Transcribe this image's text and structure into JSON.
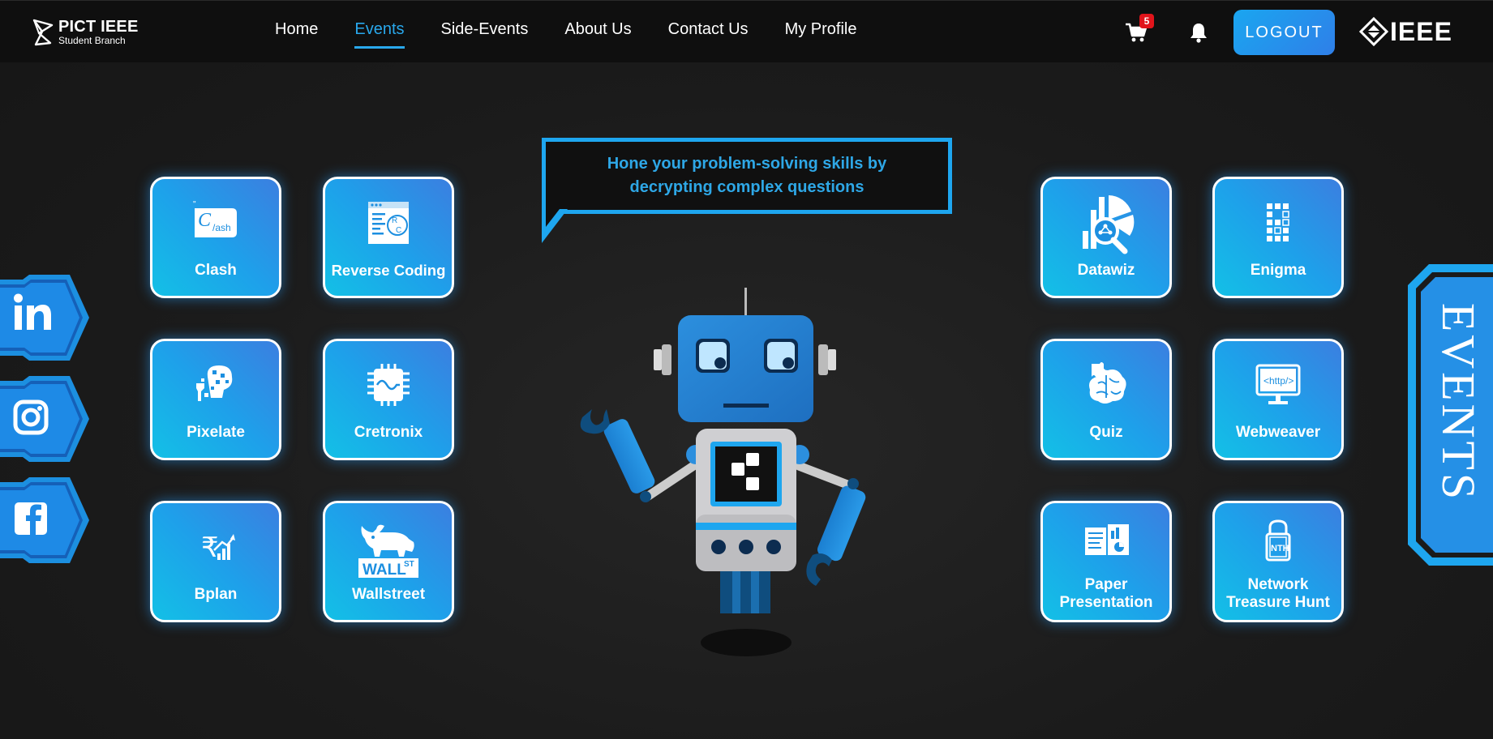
{
  "brand": {
    "title": "PICT IEEE",
    "subtitle": "Student Branch"
  },
  "nav": {
    "links": [
      {
        "label": "Home",
        "active": false
      },
      {
        "label": "Events",
        "active": true
      },
      {
        "label": "Side-Events",
        "active": false
      },
      {
        "label": "About Us",
        "active": false
      },
      {
        "label": "Contact Us",
        "active": false
      },
      {
        "label": "My Profile",
        "active": false
      }
    ],
    "cart_count": "5",
    "logout_label": "LOGOUT",
    "ieee_logo_text": "IEEE"
  },
  "bubble": {
    "text": "Hone your problem-solving skills by decrypting complex questions"
  },
  "events_tab_label": "EVENTS",
  "events_left": [
    {
      "name": "Clash",
      "icon": "clash-icon"
    },
    {
      "name": "Reverse Coding",
      "icon": "reverse-coding-icon"
    },
    {
      "name": "Pixelate",
      "icon": "pixelate-icon"
    },
    {
      "name": "Cretronix",
      "icon": "cretronix-chip-icon"
    },
    {
      "name": "Bplan",
      "icon": "bplan-rupee-icon"
    },
    {
      "name": "Wallstreet",
      "icon": "wallstreet-bull-icon"
    }
  ],
  "events_right": [
    {
      "name": "Datawiz",
      "icon": "datawiz-chart-icon"
    },
    {
      "name": "Enigma",
      "icon": "enigma-icon"
    },
    {
      "name": "Quiz",
      "icon": "quiz-brain-icon"
    },
    {
      "name": "Webweaver",
      "icon": "webweaver-monitor-icon"
    },
    {
      "name": "Paper Presentation",
      "icon": "paper-presentation-icon"
    },
    {
      "name": "Network Treasure Hunt",
      "icon": "network-treasure-hunt-icon"
    }
  ],
  "social": [
    "linkedin-icon",
    "instagram-icon",
    "facebook-icon"
  ],
  "colors": {
    "accent": "#29a8ec",
    "badge": "#e1141b",
    "card_start": "#13c0e6",
    "card_end": "#3b7fe0"
  }
}
